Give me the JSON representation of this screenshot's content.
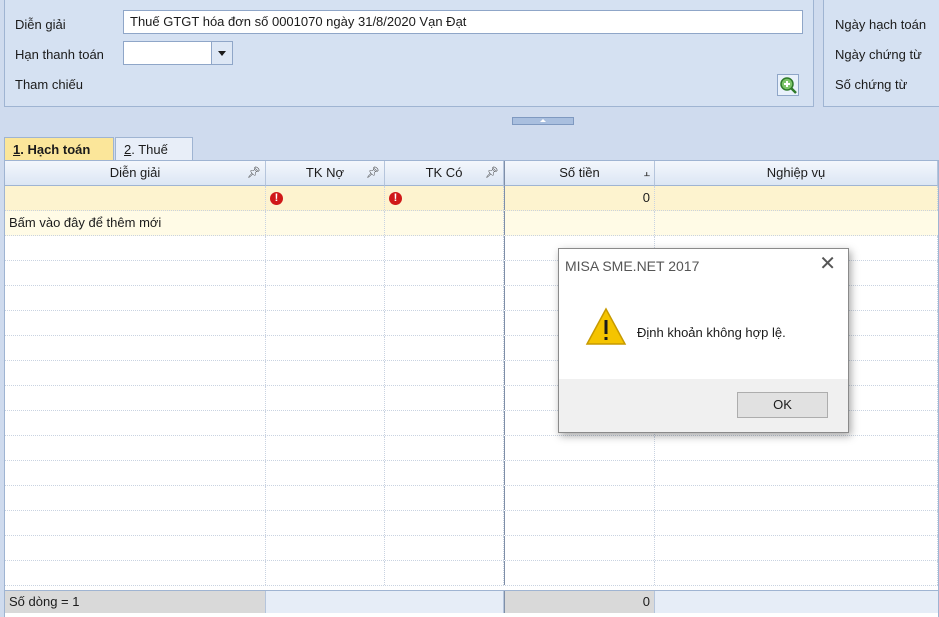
{
  "form": {
    "description_label": "Diễn giải",
    "description_value": "Thuế GTGT hóa đơn số 0001070 ngày 31/8/2020 Vạn Đạt",
    "due_label": "Hạn thanh toán",
    "reference_label": "Tham chiếu"
  },
  "right_panel": {
    "posting_date_label": "Ngày hạch toán",
    "voucher_date_label": "Ngày chứng từ",
    "voucher_no_label": "Số chứng từ"
  },
  "tabs": [
    {
      "num": "1",
      "label": ". Hạch toán"
    },
    {
      "num": "2",
      "label": ". Thuế"
    }
  ],
  "grid": {
    "columns": [
      "Diễn giải",
      "TK Nợ",
      "TK Có",
      "Số tiền",
      "Nghiệp vụ"
    ],
    "first_row": {
      "amount": "0"
    },
    "add_new_text": "Bấm vào đây để thêm mới",
    "footer_count": "Số dòng = 1",
    "footer_total": "0"
  },
  "dialog": {
    "title": "MISA SME.NET 2017",
    "message": "Định khoản không hợp lệ.",
    "ok_label": "OK"
  },
  "colors": {
    "accent_tab": "#fbe69a",
    "error": "#d01818",
    "warning": "#f5c400"
  },
  "icons": [
    "dropdown-arrow-icon",
    "search-zoom-icon",
    "pin-icon",
    "error-icon",
    "warning-icon",
    "close-icon"
  ]
}
